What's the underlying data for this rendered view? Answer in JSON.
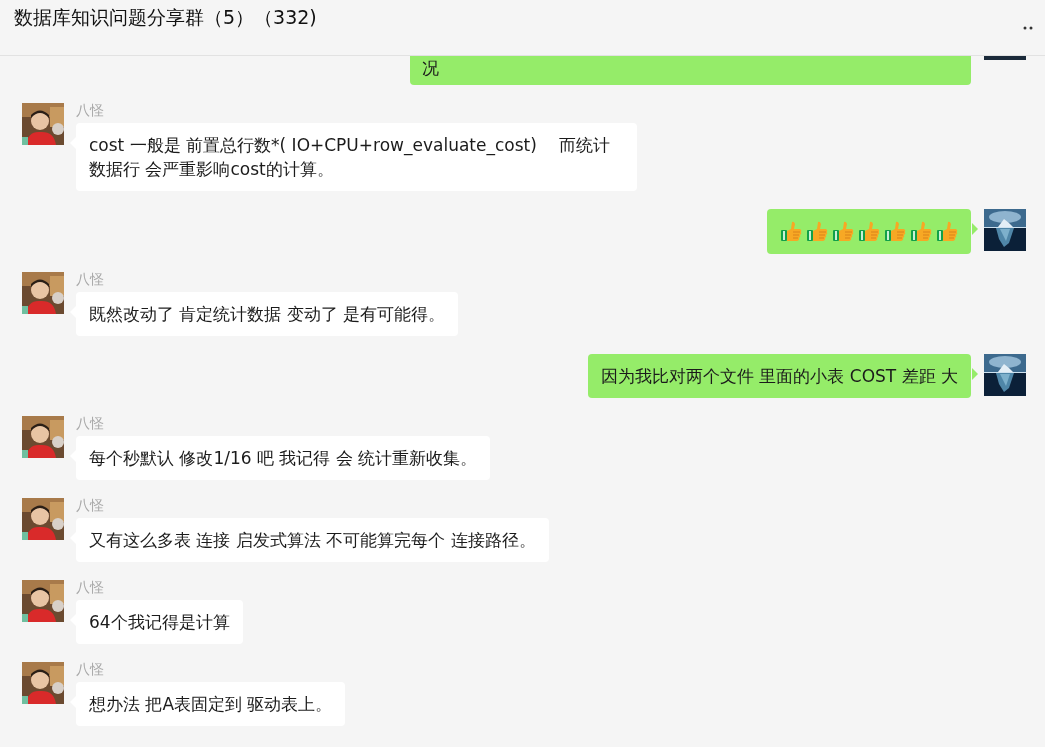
{
  "window": {
    "title": "数据库知识问题分享群（5）（332)"
  },
  "messages": [
    {
      "kind": "text",
      "outgoing": true,
      "text": "况",
      "continued": true
    },
    {
      "kind": "text",
      "outgoing": false,
      "sender": "八怪",
      "text": "cost 一般是 前置总行数*( IO+CPU+row_evaluate_cost)　 而统计数据行 会严重影响cost的计算。"
    },
    {
      "kind": "sticker",
      "outgoing": true,
      "items": [
        {
          "kind": "thumbs_up"
        },
        {
          "kind": "thumbs_up"
        },
        {
          "kind": "thumbs_up"
        },
        {
          "kind": "thumbs_up"
        },
        {
          "kind": "thumbs_up"
        },
        {
          "kind": "thumbs_up"
        },
        {
          "kind": "thumbs_up"
        }
      ]
    },
    {
      "kind": "text",
      "outgoing": false,
      "sender": "八怪",
      "text": "既然改动了 肯定统计数据 变动了 是有可能得。"
    },
    {
      "kind": "text",
      "outgoing": true,
      "text": "因为我比对两个文件 里面的小表 COST 差距 大"
    },
    {
      "kind": "text",
      "outgoing": false,
      "sender": "八怪",
      "text": "每个秒默认 修改1/16 吧 我记得 会 统计重新收集。"
    },
    {
      "kind": "text",
      "outgoing": false,
      "sender": "八怪",
      "text": "又有这么多表 连接 启发式算法 不可能算完每个 连接路径。"
    },
    {
      "kind": "text",
      "outgoing": false,
      "sender": "八怪",
      "text": "64个我记得是计算"
    },
    {
      "kind": "text",
      "outgoing": false,
      "sender": "八怪",
      "text": "想办法 把A表固定到 驱动表上。"
    }
  ]
}
